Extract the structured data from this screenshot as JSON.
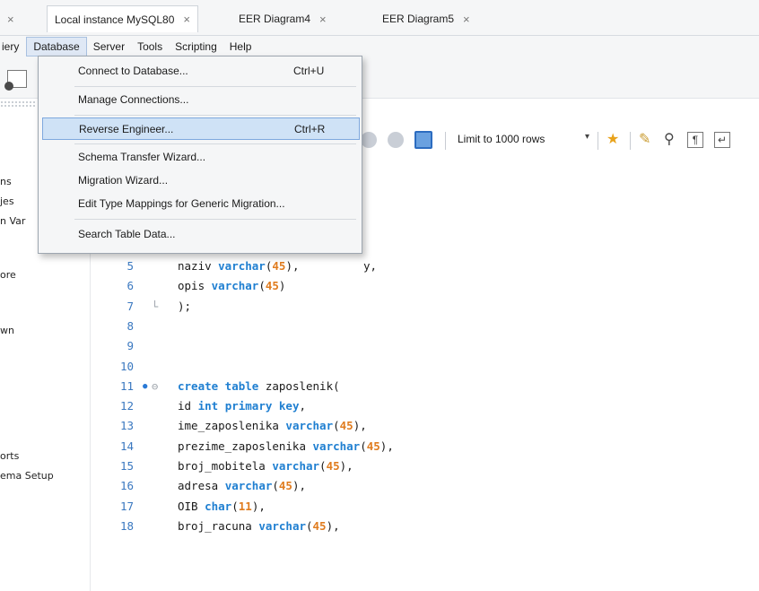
{
  "tabs": [
    {
      "label": "",
      "close": "×"
    },
    {
      "label": "Local instance MySQL80",
      "close": "×"
    },
    {
      "label": "EER Diagram4",
      "close": "×"
    },
    {
      "label": "EER Diagram5",
      "close": "×"
    }
  ],
  "menubar": {
    "query_partial": "iery",
    "database": "Database",
    "server": "Server",
    "tools": "Tools",
    "scripting": "Scripting",
    "help": "Help"
  },
  "database_menu": {
    "items": [
      {
        "label": "Connect to Database...",
        "shortcut": "Ctrl+U"
      },
      {
        "label": "Manage Connections...",
        "shortcut": ""
      },
      {
        "label": "Reverse Engineer...",
        "shortcut": "Ctrl+R",
        "highlighted": true
      },
      {
        "label": "Schema Transfer Wizard...",
        "shortcut": ""
      },
      {
        "label": "Migration Wizard...",
        "shortcut": ""
      },
      {
        "label": "Edit Type Mappings for Generic Migration...",
        "shortcut": ""
      },
      {
        "label": "Search Table Data...",
        "shortcut": ""
      }
    ]
  },
  "query_toolbar": {
    "limit_label": "Limit to 1000 rows",
    "dropdown_arrow": "▾",
    "icons": [
      "stop-icon",
      "cancel-icon",
      "toggle-autocommit-icon",
      "favorite-star-icon",
      "beautify-icon",
      "find-icon",
      "invisible-chars-icon",
      "wrap-icon"
    ]
  },
  "sidebar_fragments": [
    "ns",
    "jes",
    "n Var",
    "ore",
    "wn",
    "orts",
    "ema Setup"
  ],
  "editor": {
    "partial_line_suffix": "y,",
    "lines": [
      {
        "n": "5",
        "tokens": [
          [
            "naziv ",
            ""
          ],
          [
            "varchar",
            "kw"
          ],
          [
            "(",
            ""
          ],
          [
            "45",
            "num"
          ],
          "),"
        ]
      },
      {
        "n": "6",
        "tokens": [
          [
            "opis ",
            ""
          ],
          [
            "varchar",
            "kw"
          ],
          [
            "(",
            ""
          ],
          [
            "45",
            "num"
          ],
          [
            ")",
            ""
          ]
        ]
      },
      {
        "n": "7",
        "tokens": [
          [
            ");",
            ""
          ]
        ]
      },
      {
        "n": "8",
        "tokens": []
      },
      {
        "n": "9",
        "tokens": []
      },
      {
        "n": "10",
        "tokens": []
      },
      {
        "n": "11",
        "marker": "●",
        "fold": "⊖",
        "tokens": [
          [
            "create table",
            "kw"
          ],
          [
            " zaposlenik(",
            ""
          ]
        ]
      },
      {
        "n": "12",
        "tokens": [
          [
            "id ",
            ""
          ],
          [
            "int",
            "kw"
          ],
          [
            " ",
            ""
          ],
          [
            "primary key",
            "kw"
          ],
          [
            ",",
            ""
          ]
        ]
      },
      {
        "n": "13",
        "tokens": [
          [
            "ime_zaposlenika ",
            ""
          ],
          [
            "varchar",
            "kw"
          ],
          [
            "(",
            ""
          ],
          [
            "45",
            "num"
          ],
          [
            "),",
            ""
          ]
        ]
      },
      {
        "n": "14",
        "tokens": [
          [
            "prezime_zaposlenika ",
            ""
          ],
          [
            "varchar",
            "kw"
          ],
          [
            "(",
            ""
          ],
          [
            "45",
            "num"
          ],
          [
            "),",
            ""
          ]
        ]
      },
      {
        "n": "15",
        "tokens": [
          [
            "broj_mobitela ",
            ""
          ],
          [
            "varchar",
            "kw"
          ],
          [
            "(",
            ""
          ],
          [
            "45",
            "num"
          ],
          [
            "),",
            ""
          ]
        ]
      },
      {
        "n": "16",
        "tokens": [
          [
            "adresa ",
            ""
          ],
          [
            "varchar",
            "kw"
          ],
          [
            "(",
            ""
          ],
          [
            "45",
            "num"
          ],
          [
            "),",
            ""
          ]
        ]
      },
      {
        "n": "17",
        "tokens": [
          [
            "OIB ",
            ""
          ],
          [
            "char",
            "kw"
          ],
          [
            "(",
            ""
          ],
          [
            "11",
            "num"
          ],
          [
            "),",
            ""
          ]
        ]
      },
      {
        "n": "18",
        "tokens": [
          [
            "broj_racuna ",
            ""
          ],
          [
            "varchar",
            "kw"
          ],
          [
            "(",
            ""
          ],
          [
            "45",
            "num"
          ],
          [
            "),",
            ""
          ]
        ]
      }
    ]
  },
  "colors": {
    "keyword": "#1f7fd1",
    "number": "#e07c1f",
    "line_number": "#3a78c0",
    "menu_highlight": "#cfe2f6"
  }
}
